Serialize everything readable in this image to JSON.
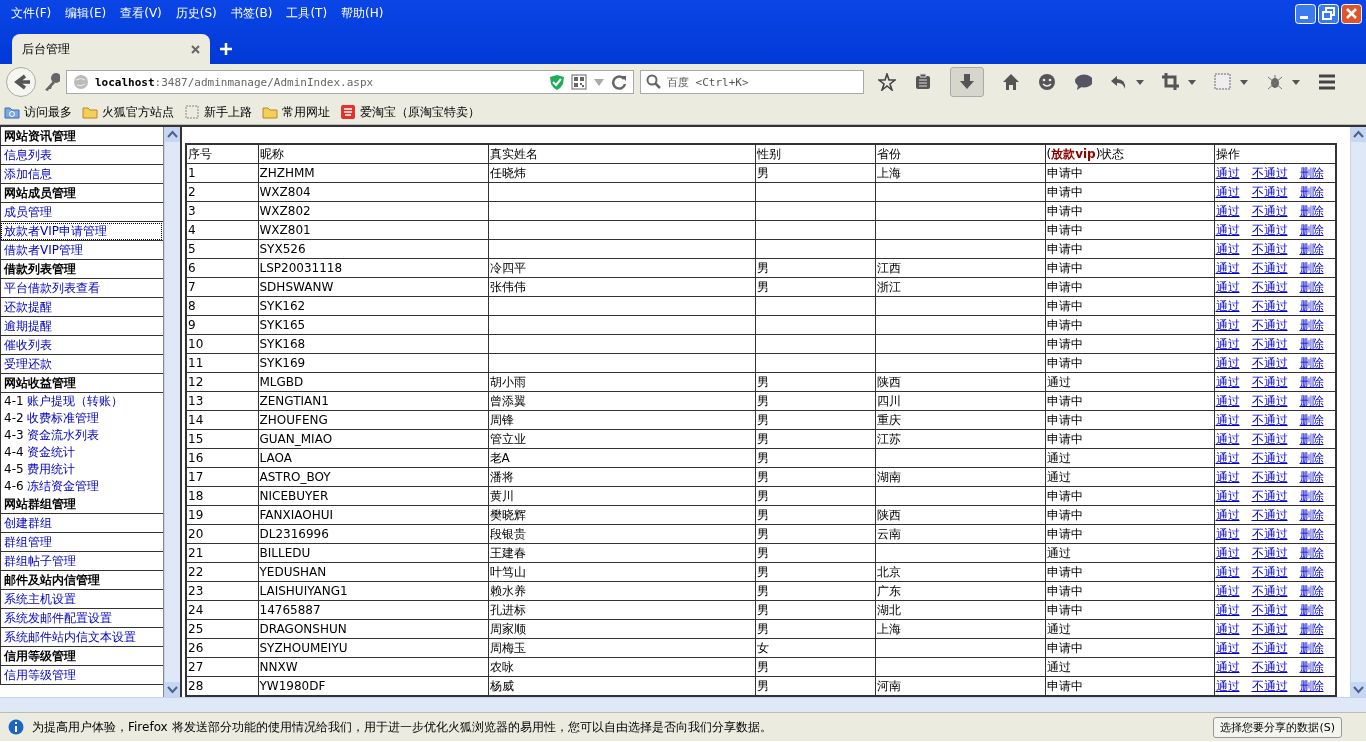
{
  "menu": [
    "文件(F)",
    "编辑(E)",
    "查看(V)",
    "历史(S)",
    "书签(B)",
    "工具(T)",
    "帮助(H)"
  ],
  "tabs": [
    {
      "title": "后台管理",
      "selected": true
    }
  ],
  "address": {
    "host": "localhost",
    "path": ":3487/adminmanage/AdminIndex.aspx"
  },
  "search": {
    "placeholder": "百度 <Ctrl+K>"
  },
  "bookmarks": [
    {
      "label": "访问最多",
      "kind": "smart"
    },
    {
      "label": "火狐官方站点",
      "kind": "folder"
    },
    {
      "label": "新手上路",
      "kind": "blank"
    },
    {
      "label": "常用网址",
      "kind": "folder"
    },
    {
      "label": "爱淘宝（原淘宝特卖）",
      "kind": "shop"
    }
  ],
  "sidebar": [
    {
      "title": "网站资讯管理",
      "items": [
        {
          "label": "信息列表",
          "focused": false
        },
        {
          "label": "添加信息",
          "focused": false
        }
      ]
    },
    {
      "title": "网站成员管理",
      "items": [
        {
          "label": "成员管理",
          "focused": false
        },
        {
          "label": "放款者VIP申请管理",
          "focused": true
        },
        {
          "label": "借款者VIP管理",
          "focused": false
        }
      ]
    },
    {
      "title": "借款列表管理",
      "items": [
        {
          "label": "平台借款列表查看",
          "focused": false
        },
        {
          "label": "还款提醒",
          "focused": false
        },
        {
          "label": "逾期提醒",
          "focused": false
        },
        {
          "label": "催收列表",
          "focused": false
        },
        {
          "label": "受理还款",
          "focused": false
        }
      ]
    },
    {
      "title": "网站收益管理",
      "items": [
        {
          "number": "4-1",
          "label": "账户提现（转账）",
          "focused": false
        },
        {
          "number": "4-2",
          "label": "收费标准管理",
          "focused": false
        },
        {
          "number": "4-3",
          "label": "资金流水列表",
          "focused": false
        },
        {
          "number": "4-4",
          "label": "资金统计",
          "focused": false
        },
        {
          "number": "4-5",
          "label": "费用统计",
          "focused": false
        },
        {
          "number": "4-6",
          "label": "冻结资金管理",
          "focused": false
        }
      ]
    },
    {
      "title": "网站群组管理",
      "items": [
        {
          "label": "创建群组",
          "focused": false
        },
        {
          "label": "群组管理",
          "focused": false
        },
        {
          "label": "群组帖子管理",
          "focused": false
        }
      ]
    },
    {
      "title": "邮件及站内信管理",
      "items": [
        {
          "label": "系统主机设置",
          "focused": false
        },
        {
          "label": "系统发邮件配置设置",
          "focused": false
        },
        {
          "label": "系统邮件站内信文本设置",
          "focused": false
        }
      ]
    },
    {
      "title": "信用等级管理",
      "items": [
        {
          "label": "信用等级管理",
          "focused": false
        }
      ]
    }
  ],
  "table": {
    "columns": [
      "序号",
      "昵称",
      "真实姓名",
      "性别",
      "省份",
      "(**放款vip**)状态",
      "操作"
    ],
    "rows": [
      {
        "no": "1",
        "nickname": "ZHZHMM",
        "real_name": "任晓炜",
        "gender": "男",
        "province": "上海",
        "status": "申请中",
        "actions": [
          "通过",
          "不通过",
          "删除"
        ]
      },
      {
        "no": "2",
        "nickname": "WXZ804",
        "status": "申请中",
        "actions": [
          "通过",
          "不通过",
          "删除"
        ]
      },
      {
        "no": "3",
        "nickname": "WXZ802",
        "status": "申请中",
        "actions": [
          "通过",
          "不通过",
          "删除"
        ]
      },
      {
        "no": "4",
        "nickname": "WXZ801",
        "status": "申请中",
        "actions": [
          "通过",
          "不通过",
          "删除"
        ]
      },
      {
        "no": "5",
        "nickname": "SYX526",
        "status": "申请中",
        "actions": [
          "通过",
          "不通过",
          "删除"
        ]
      },
      {
        "no": "6",
        "nickname": "LSP20031118",
        "real_name": "冷四平",
        "gender": "男",
        "province": "江西",
        "status": "申请中",
        "actions": [
          "通过",
          "不通过",
          "删除"
        ]
      },
      {
        "no": "7",
        "nickname": "SDHSWANW",
        "real_name": "张伟伟",
        "gender": "男",
        "province": "浙江",
        "status": "申请中",
        "actions": [
          "通过",
          "不通过",
          "删除"
        ]
      },
      {
        "no": "8",
        "nickname": "SYK162",
        "status": "申请中",
        "actions": [
          "通过",
          "不通过",
          "删除"
        ]
      },
      {
        "no": "9",
        "nickname": "SYK165",
        "status": "申请中",
        "actions": [
          "通过",
          "不通过",
          "删除"
        ]
      },
      {
        "no": "10",
        "nickname": "SYK168",
        "status": "申请中",
        "actions": [
          "通过",
          "不通过",
          "删除"
        ]
      },
      {
        "no": "11",
        "nickname": "SYK169",
        "status": "申请中",
        "actions": [
          "通过",
          "不通过",
          "删除"
        ]
      },
      {
        "no": "12",
        "nickname": "MLGBD",
        "real_name": "胡小雨",
        "gender": "男",
        "province": "陕西",
        "status": "通过",
        "actions": [
          "通过",
          "不通过",
          "删除"
        ]
      },
      {
        "no": "13",
        "nickname": "ZENGTIAN1",
        "real_name": "曾添翼",
        "gender": "男",
        "province": "四川",
        "status": "申请中",
        "actions": [
          "通过",
          "不通过",
          "删除"
        ]
      },
      {
        "no": "14",
        "nickname": "ZHOUFENG",
        "real_name": "周锋",
        "gender": "男",
        "province": "重庆",
        "status": "申请中",
        "actions": [
          "通过",
          "不通过",
          "删除"
        ]
      },
      {
        "no": "15",
        "nickname": "GUAN_MIAO",
        "real_name": "管立业",
        "gender": "男",
        "province": "江苏",
        "status": "申请中",
        "actions": [
          "通过",
          "不通过",
          "删除"
        ]
      },
      {
        "no": "16",
        "nickname": "LAOA",
        "real_name": "老A",
        "gender": "男",
        "status": "通过",
        "actions": [
          "通过",
          "不通过",
          "删除"
        ]
      },
      {
        "no": "17",
        "nickname": "ASTRO_BOY",
        "real_name": "潘将",
        "gender": "男",
        "province": "湖南",
        "status": "通过",
        "actions": [
          "通过",
          "不通过",
          "删除"
        ]
      },
      {
        "no": "18",
        "nickname": "NICEBUYER",
        "real_name": "黄川",
        "gender": "男",
        "status": "申请中",
        "actions": [
          "通过",
          "不通过",
          "删除"
        ]
      },
      {
        "no": "19",
        "nickname": "FANXIAOHUI",
        "real_name": "樊晓辉",
        "gender": "男",
        "province": "陕西",
        "status": "申请中",
        "actions": [
          "通过",
          "不通过",
          "删除"
        ]
      },
      {
        "no": "20",
        "nickname": "DL2316996",
        "real_name": "段银贵",
        "gender": "男",
        "province": "云南",
        "status": "申请中",
        "actions": [
          "通过",
          "不通过",
          "删除"
        ]
      },
      {
        "no": "21",
        "nickname": "BILLEDU",
        "real_name": "王建春",
        "gender": "男",
        "status": "通过",
        "actions": [
          "通过",
          "不通过",
          "删除"
        ]
      },
      {
        "no": "22",
        "nickname": "YEDUSHAN",
        "real_name": "叶笃山",
        "gender": "男",
        "province": "北京",
        "status": "申请中",
        "actions": [
          "通过",
          "不通过",
          "删除"
        ]
      },
      {
        "no": "23",
        "nickname": "LAISHUIYANG1",
        "real_name": "赖水养",
        "gender": "男",
        "province": "广东",
        "status": "申请中",
        "actions": [
          "通过",
          "不通过",
          "删除"
        ]
      },
      {
        "no": "24",
        "nickname": "14765887",
        "real_name": "孔进标",
        "gender": "男",
        "province": "湖北",
        "status": "申请中",
        "actions": [
          "通过",
          "不通过",
          "删除"
        ]
      },
      {
        "no": "25",
        "nickname": "DRAGONSHUN",
        "real_name": "周家顺",
        "gender": "男",
        "province": "上海",
        "status": "通过",
        "actions": [
          "通过",
          "不通过",
          "删除"
        ]
      },
      {
        "no": "26",
        "nickname": "SYZHOUMEIYU",
        "real_name": "周梅玉",
        "gender": "女",
        "status": "申请中",
        "actions": [
          "通过",
          "不通过",
          "删除"
        ]
      },
      {
        "no": "27",
        "nickname": "NNXW",
        "real_name": "农咏",
        "gender": "男",
        "status": "通过",
        "actions": [
          "通过",
          "不通过",
          "删除"
        ]
      },
      {
        "no": "28",
        "nickname": "YW1980DF",
        "real_name": "杨威",
        "gender": "男",
        "province": "河南",
        "status": "申请中",
        "actions": [
          "通过",
          "不通过",
          "删除"
        ]
      }
    ]
  },
  "notice": {
    "text": "为提高用户体验，Firefox 将发送部分功能的使用情况给我们，用于进一步优化火狐浏览器的易用性，您可以自由选择是否向我们分享数据。",
    "button": "选择您要分享的数据(S)"
  }
}
